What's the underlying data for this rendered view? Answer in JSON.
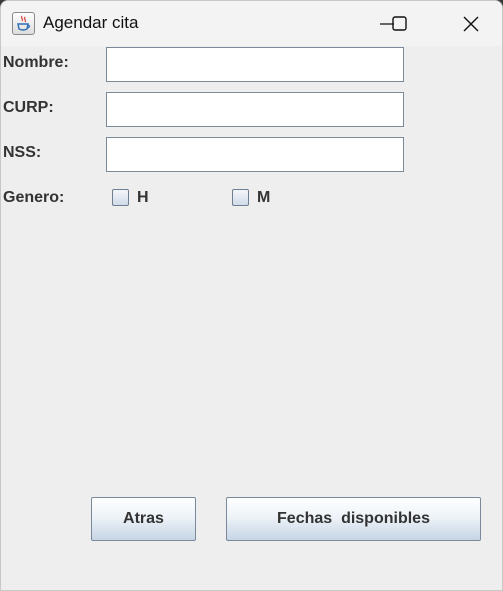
{
  "window": {
    "title": "Agendar cita",
    "icon": "java-cup-icon",
    "controls": [
      "minimize-icon",
      "maximize-icon",
      "close-icon"
    ]
  },
  "form": {
    "nombre": {
      "label": "Nombre:",
      "value": ""
    },
    "curp": {
      "label": "CURP:",
      "value": ""
    },
    "nss": {
      "label": "NSS:",
      "value": ""
    },
    "genero": {
      "label": "Genero:",
      "options": [
        {
          "label": "H",
          "checked": false
        },
        {
          "label": "M",
          "checked": false
        }
      ]
    }
  },
  "buttons": {
    "back": "Atras",
    "available_dates": "Fechas  disponibles"
  },
  "colors": {
    "window_bg": "#eeeeee",
    "titlebar_bg": "#f3f3f3",
    "button_gradient_bottom": "#c6d5e5"
  }
}
